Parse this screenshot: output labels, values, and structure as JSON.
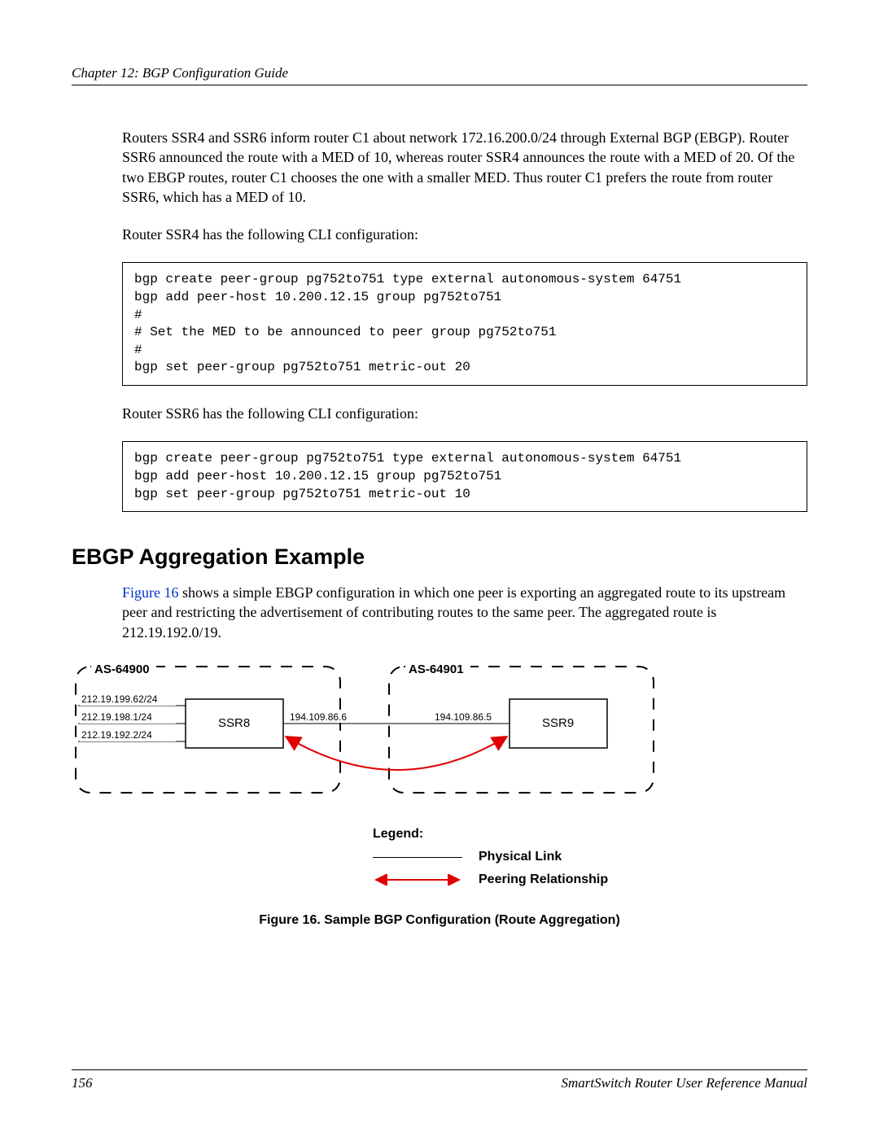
{
  "header": {
    "chapter": "Chapter 12: BGP Configuration Guide"
  },
  "para1": "Routers SSR4 and SSR6 inform router C1 about network 172.16.200.0/24 through External BGP (EBGP). Router SSR6 announced the route with a MED of 10, whereas router SSR4 announces the route with a MED of 20. Of the two EBGP routes, router C1 chooses the one with a smaller MED. Thus router C1 prefers the route from router SSR6, which has a MED of 10.",
  "para2": "Router SSR4 has the following CLI configuration:",
  "code1": "bgp create peer-group pg752to751 type external autonomous-system 64751\nbgp add peer-host 10.200.12.15 group pg752to751\n#\n# Set the MED to be announced to peer group pg752to751\n#\nbgp set peer-group pg752to751 metric-out 20",
  "para3": "Router SSR6 has the following CLI configuration:",
  "code2": "bgp create peer-group pg752to751 type external autonomous-system 64751\nbgp add peer-host 10.200.12.15 group pg752to751\nbgp set peer-group pg752to751 metric-out 10",
  "section_heading": "EBGP Aggregation Example",
  "para4_ref": "Figure 16",
  "para4_rest": " shows a simple EBGP configuration in which one peer is exporting an aggregated route to its upstream peer and restricting the advertisement of contributing routes to the same peer. The aggregated route is 212.19.192.0/19.",
  "diagram": {
    "as_left": "AS-64900",
    "as_right": "AS-64901",
    "router_left": "SSR8",
    "router_right": "SSR9",
    "ip_left_1": "212.19.199.62/24",
    "ip_left_2": "212.19.198.1/24",
    "ip_left_3": "212.19.192.2/24",
    "ip_link_left": "194.109.86.6",
    "ip_link_right": "194.109.86.5"
  },
  "legend": {
    "title": "Legend:",
    "physical": "Physical Link",
    "peering": "Peering Relationship"
  },
  "fig_caption": "Figure 16.  Sample BGP Configuration (Route Aggregation)",
  "footer": {
    "page": "156",
    "manual": "SmartSwitch Router User Reference Manual"
  }
}
